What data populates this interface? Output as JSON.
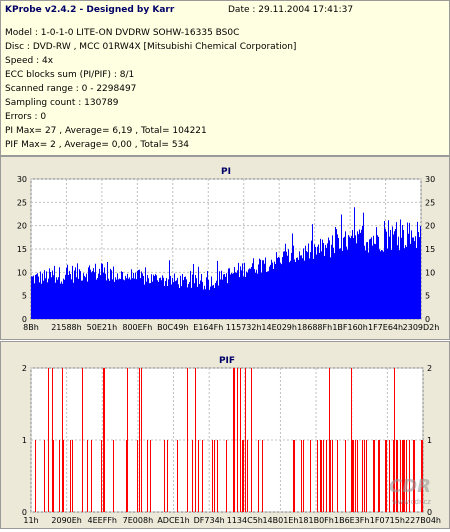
{
  "info": {
    "title": "KProbe v2.4.2 - Designed by Karr",
    "date": "Date : 29.11.2004 17:41:37",
    "lines": [
      "Model : 1-0-1-0 LITE-ON DVDRW SOHW-16335 BS0C",
      "Disc : DVD-RW , MCC 01RW4X  [Mitsubishi Chemical Corporation]",
      "Speed : 4x",
      "ECC blocks sum (PI/PIF) : 8/1",
      "Scanned range : 0 - 2298497",
      "Sampling count : 130789",
      "Errors : 0",
      "PI Max= 27 , Average= 6,19 , Total= 104221",
      "PIF Max= 2 , Average= 0,00 , Total= 534"
    ]
  },
  "watermark": "CDR",
  "watermark_url": "www.cdr.cz",
  "chart_data": [
    {
      "type": "bar",
      "title": "PI",
      "ylim": [
        0,
        30
      ],
      "yticks": [
        0,
        5,
        10,
        15,
        20,
        25,
        30
      ],
      "xtick_labels": [
        "8Bh",
        "21588h",
        "50E21h",
        "800EFh",
        "B0C49h",
        "E164Fh",
        "115732h",
        "14E029h",
        "18688Fh",
        "1BF160h",
        "1F7E64h",
        "2309D2h"
      ],
      "grid": true,
      "color": "#0000ff",
      "baseline_profile": [
        {
          "pos": 0.0,
          "base": 7,
          "peak": 13
        },
        {
          "pos": 0.15,
          "base": 8,
          "peak": 16
        },
        {
          "pos": 0.3,
          "base": 7,
          "peak": 13
        },
        {
          "pos": 0.45,
          "base": 6,
          "peak": 12
        },
        {
          "pos": 0.55,
          "base": 9,
          "peak": 16
        },
        {
          "pos": 0.7,
          "base": 12,
          "peak": 20
        },
        {
          "pos": 0.85,
          "base": 14,
          "peak": 25
        },
        {
          "pos": 1.0,
          "base": 15,
          "peak": 27
        }
      ]
    },
    {
      "type": "bar",
      "title": "PIF",
      "ylim": [
        0,
        2
      ],
      "yticks": [
        0,
        1,
        2
      ],
      "xtick_labels": [
        "11h",
        "2090Eh",
        "4EEFFh",
        "7E008h",
        "ADCE1h",
        "DF734h",
        "1134C5h",
        "14B01Eh",
        "181B0Fh",
        "1B6E3Fh",
        "1F0715h",
        "227B04h"
      ],
      "grid": true,
      "color": "#ff0000",
      "max": 2,
      "total": 534
    }
  ]
}
